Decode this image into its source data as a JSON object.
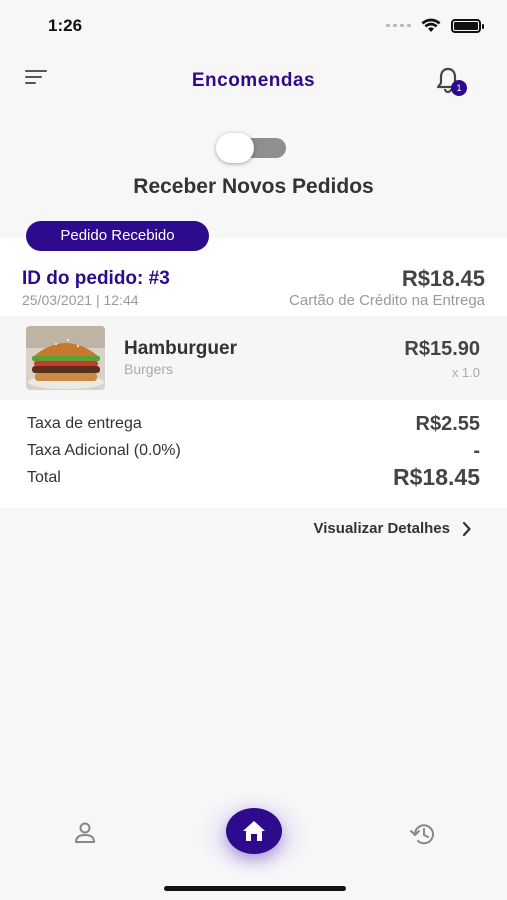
{
  "status_bar": {
    "time": "1:26"
  },
  "header": {
    "title": "Encomendas",
    "notification_count": "1"
  },
  "toggle": {
    "label": "Receber Novos Pedidos",
    "on": false
  },
  "order": {
    "status": "Pedido Recebido",
    "id_label": "ID do pedido: #3",
    "datetime": "25/03/2021 | 12:44",
    "total": "R$18.45",
    "payment": "Cartão de Crédito na Entrega",
    "items": [
      {
        "name": "Hamburguer",
        "category": "Burgers",
        "price": "R$15.90",
        "qty": "x 1.0"
      }
    ],
    "summary": {
      "delivery_label": "Taxa de entrega",
      "delivery_value": "R$2.55",
      "additional_label": "Taxa Adicional (0.0%)",
      "additional_value": "-",
      "total_label": "Total",
      "total_value": "R$18.45"
    },
    "details_link": "Visualizar Detalhes"
  },
  "colors": {
    "accent": "#2e0a8c"
  }
}
